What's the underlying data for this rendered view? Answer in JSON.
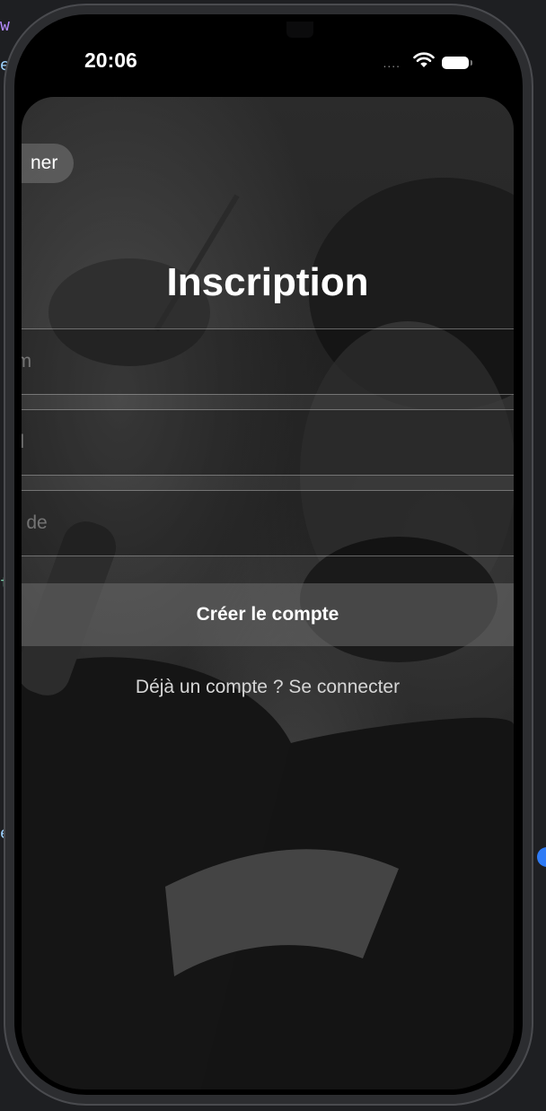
{
  "status_bar": {
    "time": "20:06",
    "signal_dots": "....",
    "wifi_icon": "wifi-icon",
    "battery_icon": "battery-icon"
  },
  "nav": {
    "back_label": "ner"
  },
  "page": {
    "title": "Inscription"
  },
  "form": {
    "name_placeholder": "om",
    "email_placeholder": "ail",
    "password_placeholder": "ot de"
  },
  "actions": {
    "create_label": "Créer le compte",
    "login_link": "Déjà un compte ? Se connecter"
  },
  "colors": {
    "background": "#000000",
    "text": "#ffffff",
    "button_bg": "#6e6e6e",
    "editor_accent": "#2f7cf6"
  }
}
